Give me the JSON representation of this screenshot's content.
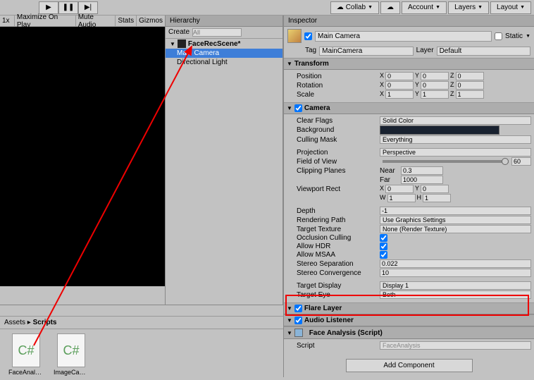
{
  "toolbar": {
    "collab": "Collab",
    "account": "Account",
    "layers": "Layers",
    "layout": "Layout",
    "zoom": "1x",
    "maxOnPlay": "Maximize On Play",
    "muteAudio": "Mute Audio",
    "stats": "Stats",
    "gizmos": "Gizmos"
  },
  "hierarchy": {
    "title": "Hierarchy",
    "create": "Create",
    "searchPlaceholder": "All",
    "scene": "FaceRecScene*",
    "items": [
      "Main Camera",
      "Directional Light"
    ]
  },
  "inspector": {
    "title": "Inspector",
    "goName": "Main Camera",
    "static": "Static",
    "tagLabel": "Tag",
    "tag": "MainCamera",
    "layerLabel": "Layer",
    "layer": "Default",
    "transform": {
      "title": "Transform",
      "position": "Position",
      "rotation": "Rotation",
      "scale": "Scale",
      "pos": {
        "x": "0",
        "y": "0",
        "z": "0"
      },
      "rot": {
        "x": "0",
        "y": "0",
        "z": "0"
      },
      "scl": {
        "x": "1",
        "y": "1",
        "z": "1"
      }
    },
    "camera": {
      "title": "Camera",
      "clearFlagsLabel": "Clear Flags",
      "clearFlags": "Solid Color",
      "bgLabel": "Background",
      "bgColor": "#192230",
      "cullingMaskLabel": "Culling Mask",
      "cullingMask": "Everything",
      "projectionLabel": "Projection",
      "projection": "Perspective",
      "fovLabel": "Field of View",
      "fov": "60",
      "clipLabel": "Clipping Planes",
      "near": "Near",
      "nearVal": "0.3",
      "far": "Far",
      "farVal": "1000",
      "viewportLabel": "Viewport Rect",
      "vpX": "0",
      "vpY": "0",
      "vpW": "1",
      "vpH": "1",
      "depthLabel": "Depth",
      "depth": "-1",
      "renderPathLabel": "Rendering Path",
      "renderPath": "Use Graphics Settings",
      "targetTexLabel": "Target Texture",
      "targetTex": "None (Render Texture)",
      "occLabel": "Occlusion Culling",
      "hdrLabel": "Allow HDR",
      "msaaLabel": "Allow MSAA",
      "stereoSepLabel": "Stereo Separation",
      "stereoSep": "0.022",
      "stereoConvLabel": "Stereo Convergence",
      "stereoConv": "10",
      "targetDispLabel": "Target Display",
      "targetDisp": "Display 1",
      "targetEyeLabel": "Target Eye",
      "targetEye": "Both"
    },
    "flareLayer": "Flare Layer",
    "audioListener": "Audio Listener",
    "faceAnalysis": {
      "title": "Face Analysis (Script)",
      "scriptLabel": "Script",
      "scriptVal": "FaceAnalysis"
    },
    "addComponent": "Add Component"
  },
  "project": {
    "breadcrumb1": "Assets",
    "breadcrumb2": "Scripts",
    "files": [
      "FaceAnalysi...",
      "ImageCaptu..."
    ]
  }
}
